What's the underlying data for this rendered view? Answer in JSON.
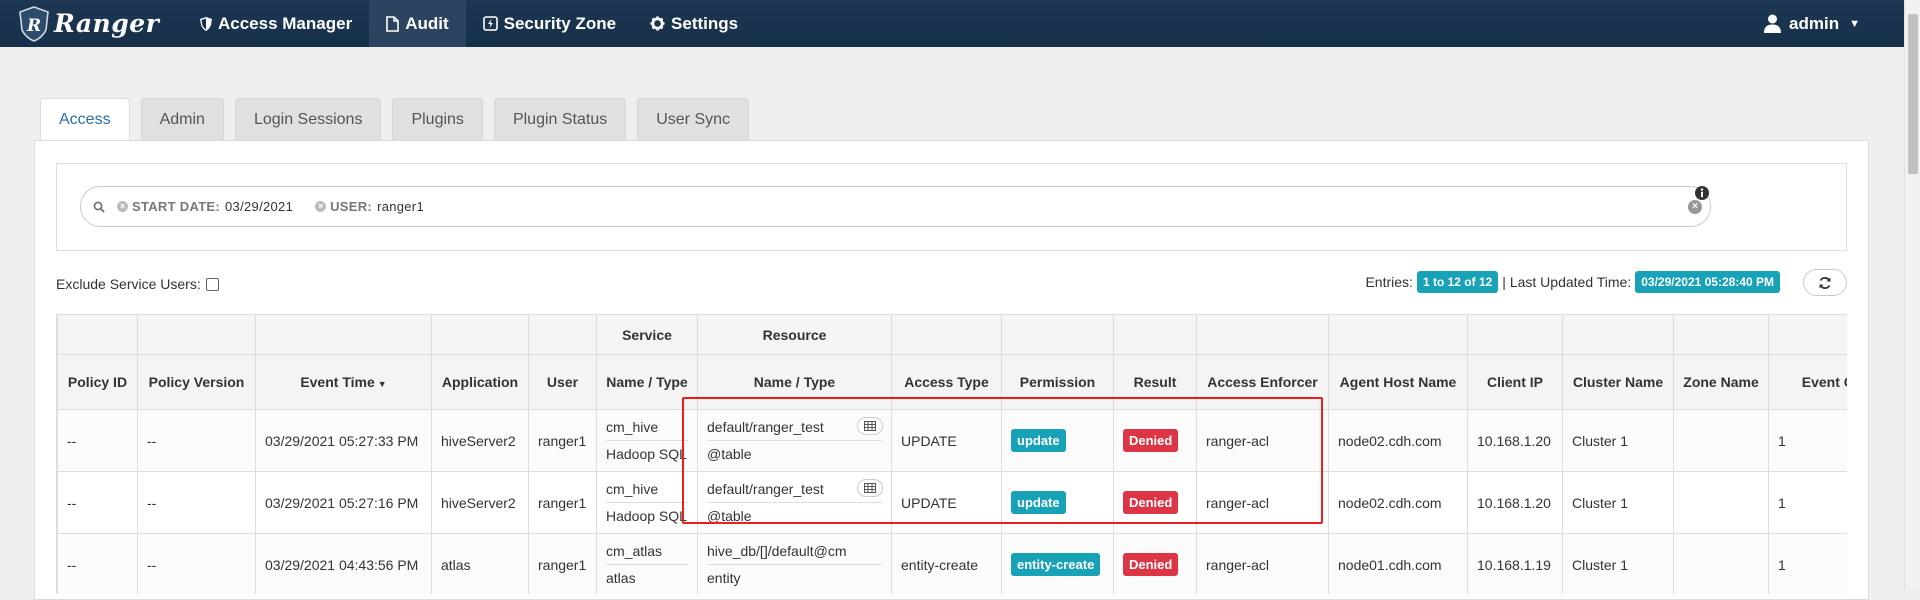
{
  "nav": {
    "brand": "Ranger",
    "items": [
      {
        "label": "Access Manager",
        "icon": "shield-icon",
        "active": false
      },
      {
        "label": "Audit",
        "icon": "file-icon",
        "active": true
      },
      {
        "label": "Security Zone",
        "icon": "zone-icon",
        "active": false
      },
      {
        "label": "Settings",
        "icon": "gear-icon",
        "active": false
      }
    ],
    "user": "admin"
  },
  "tabs": [
    "Access",
    "Admin",
    "Login Sessions",
    "Plugins",
    "Plugin Status",
    "User Sync"
  ],
  "search": {
    "facets": [
      {
        "key": "START DATE:",
        "value": "03/29/2021"
      },
      {
        "key": "USER:",
        "value": "ranger1"
      }
    ]
  },
  "exclude_label": "Exclude Service Users:",
  "entries": {
    "label": "Entries:",
    "range": "1 to 12 of 12",
    "updated_label": "| Last Updated Time:",
    "updated_value": "03/29/2021 05:28:40 PM"
  },
  "table": {
    "group_headers": {
      "service": "Service",
      "resource": "Resource"
    },
    "headers": {
      "policy_id": "Policy ID",
      "policy_version": "Policy Version",
      "event_time": "Event Time",
      "application": "Application",
      "user": "User",
      "service": "Name / Type",
      "resource": "Name / Type",
      "access_type": "Access Type",
      "permission": "Permission",
      "result": "Result",
      "access_enforcer": "Access Enforcer",
      "agent_host": "Agent Host Name",
      "client_ip": "Client IP",
      "cluster": "Cluster Name",
      "zone": "Zone Name",
      "event_count": "Event Count"
    },
    "rows": [
      {
        "policy_id": "--",
        "policy_version": "--",
        "event_time": "03/29/2021 05:27:33 PM",
        "application": "hiveServer2",
        "user": "ranger1",
        "service_name": "cm_hive",
        "service_type": "Hadoop SQL",
        "resource_name": "default/ranger_test",
        "resource_type": "@table",
        "access_type": "UPDATE",
        "permission": "update",
        "result": "Denied",
        "access_enforcer": "ranger-acl",
        "agent_host": "node02.cdh.com",
        "client_ip": "10.168.1.20",
        "cluster": "Cluster 1",
        "zone": "",
        "event_count": "1"
      },
      {
        "policy_id": "--",
        "policy_version": "--",
        "event_time": "03/29/2021 05:27:16 PM",
        "application": "hiveServer2",
        "user": "ranger1",
        "service_name": "cm_hive",
        "service_type": "Hadoop SQL",
        "resource_name": "default/ranger_test",
        "resource_type": "@table",
        "access_type": "UPDATE",
        "permission": "update",
        "result": "Denied",
        "access_enforcer": "ranger-acl",
        "agent_host": "node02.cdh.com",
        "client_ip": "10.168.1.20",
        "cluster": "Cluster 1",
        "zone": "",
        "event_count": "1"
      },
      {
        "policy_id": "--",
        "policy_version": "--",
        "event_time": "03/29/2021 04:43:56 PM",
        "application": "atlas",
        "user": "ranger1",
        "service_name": "cm_atlas",
        "service_type": "atlas",
        "resource_name": "hive_db/[]/default@cm",
        "resource_type": "entity",
        "access_type": "entity-create",
        "permission": "entity-create",
        "result": "Denied",
        "access_enforcer": "ranger-acl",
        "agent_host": "node01.cdh.com",
        "client_ip": "10.168.1.19",
        "cluster": "Cluster 1",
        "zone": "",
        "event_count": "1"
      }
    ]
  },
  "colors": {
    "navbar": "#17304a",
    "info_badge": "#17a2b8",
    "denied": "#dc3545",
    "highlight": "#e81f1f"
  }
}
